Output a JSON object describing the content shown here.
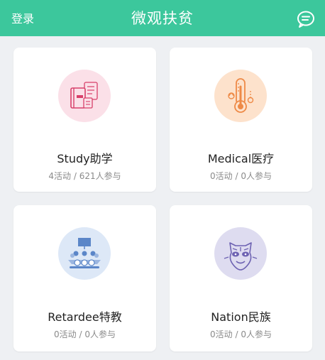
{
  "header": {
    "login_label": "登录",
    "title": "微观扶贫",
    "chat_icon": "chat-bubble-icon",
    "background_color": "#3cc79c"
  },
  "cards": [
    {
      "name": "Study助学",
      "stats": "4活动 / 621人参与",
      "icon": "books-icon",
      "circle_color": "#fbe0e8",
      "icon_color": "#d8406a"
    },
    {
      "name": "Medical医疗",
      "stats": "0活动 / 0人参与",
      "icon": "thermometer-icon",
      "circle_color": "#fde2cc",
      "icon_color": "#ee8a47"
    },
    {
      "name": "Retardee特教",
      "stats": "0活动 / 0人参与",
      "icon": "classroom-icon",
      "circle_color": "#dde8f7",
      "icon_color": "#5b86c8"
    },
    {
      "name": "Nation民族",
      "stats": "0活动 / 0人参与",
      "icon": "ethnic-mask-icon",
      "circle_color": "#dedcf0",
      "icon_color": "#6d62b2"
    }
  ]
}
